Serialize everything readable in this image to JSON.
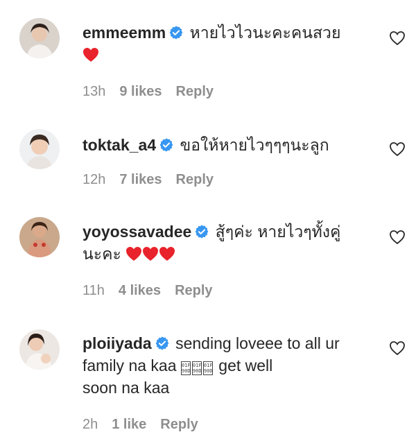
{
  "comments": [
    {
      "username": "emmeemm",
      "text": "หายไวไวนะคะคนสวย",
      "emoji_hearts": 1,
      "time": "13h",
      "likes": "9 likes",
      "reply": "Reply"
    },
    {
      "username": "toktak_a4",
      "text": "ขอให้หายไวๆๆๆนะลูก",
      "emoji_hearts": 0,
      "time": "12h",
      "likes": "7 likes",
      "reply": "Reply"
    },
    {
      "username": "yoyossavadee",
      "text": "สู้ๆค่ะ หายไวๆทั้งคู่",
      "text2": "นะคะ",
      "emoji_hearts": 3,
      "time": "11h",
      "likes": "4 likes",
      "reply": "Reply"
    },
    {
      "username": "ploiiyada",
      "text": "sending loveee to all ur",
      "text2a": "family na kaa",
      "text2b": "get well",
      "text3": "soon na kaa",
      "time": "2h",
      "likes": "1 like",
      "reply": "Reply"
    }
  ],
  "icons": {
    "verified": "verified-badge-icon",
    "like": "heart-outline-icon",
    "emoji": "red-heart-emoji"
  },
  "colors": {
    "verified_blue": "#3897f0",
    "meta_gray": "#8e8e8e",
    "heart_red": "#e8232b"
  }
}
